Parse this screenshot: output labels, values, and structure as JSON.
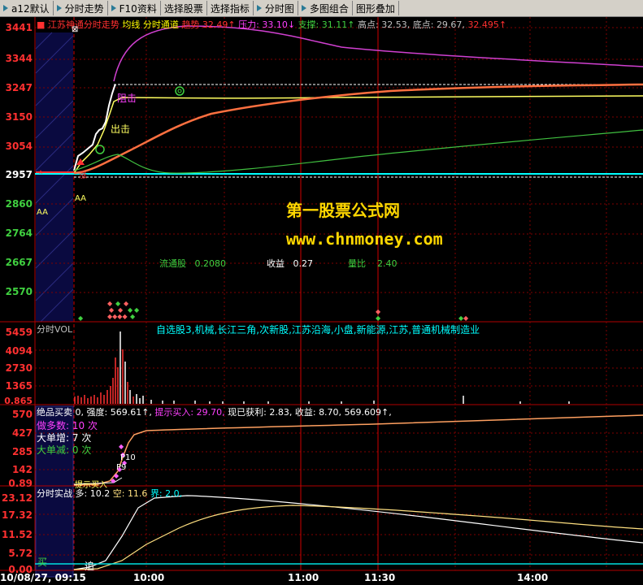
{
  "toolbar": {
    "items": [
      {
        "label": "a12默认",
        "arrow": true
      },
      {
        "label": "分时走势",
        "arrow": true
      },
      {
        "label": "F10资料",
        "arrow": true
      },
      {
        "label": "选择股票",
        "arrow": false
      },
      {
        "label": "选择指标",
        "arrow": false
      },
      {
        "label": "分时图",
        "arrow": true
      },
      {
        "label": "多图组合",
        "arrow": true
      },
      {
        "label": "图形叠加",
        "arrow": false
      }
    ]
  },
  "colors": {
    "bg": "#000000",
    "red": "#ff3030",
    "grid": "#800000",
    "yellow": "#ffff00",
    "cyan": "#00ffff",
    "magenta": "#ff40ff",
    "green": "#40d040",
    "orange": "#ff8040",
    "white": "#ffffff"
  },
  "main_panel": {
    "title": "江苏神通分时走势",
    "avg_line": "均线",
    "channel": "分时通道",
    "trend_label": "趋势",
    "trend_value": "32.49↑",
    "pressure_label": "压力:",
    "pressure_value": "33.10↓",
    "support_label": "支撑:",
    "support_value": "31.11↑",
    "high_label": "高点:",
    "high_value": "32.53,",
    "low_label": "底点:",
    "low_value": "29.67,",
    "extra_value": "32.495↑",
    "y_ticks": [
      "3441",
      "3344",
      "3247",
      "3150",
      "3054",
      "2957",
      "2860",
      "2764",
      "2667",
      "2570"
    ],
    "annotations": {
      "resist": "阻击",
      "strike": "出击",
      "aa1": "AA",
      "aa2": "AA",
      "zhang": "涨"
    },
    "stats": {
      "float_label": "流通股",
      "float_value": "0.2080",
      "eps_label": "收益",
      "eps_value": "0.27",
      "ratio_label": "量比",
      "ratio_value": "2.40"
    }
  },
  "watermark": {
    "line1": "第一股票公式网",
    "line2": "www.chnmoney.com"
  },
  "vol_panel": {
    "title": "分时VOL",
    "tags": "自选股3,机械,长江三角,次新股,江苏沿海,小盘,新能源,江苏,普通机械制造业",
    "y_ticks": [
      "5459",
      "4094",
      "2730",
      "1365",
      "0.865"
    ]
  },
  "buysell_panel": {
    "title": "绝品买卖",
    "intensity_label": "0, 强度:",
    "intensity_value": "569.61↑,",
    "hint_label": "提示买入:",
    "hint_value": "29.70,",
    "profit_label": "现已获利:",
    "profit_value": "2.83,",
    "income_label": "收益:",
    "income_value": "8.70,",
    "last_value": "569.609↑,",
    "stats": [
      {
        "label": "做多数:",
        "value": "10 次"
      },
      {
        "label": "大单增:",
        "value": "7 次"
      },
      {
        "label": "大单减:",
        "value": "0 次"
      }
    ],
    "markers": {
      "p10": "P10",
      "p9": "P9",
      "buy": "提示买入"
    },
    "y_ticks": [
      "570",
      "427",
      "285",
      "142",
      "0.89"
    ]
  },
  "battle_panel": {
    "title": "分时实战",
    "long_label": "多:",
    "long_value": "10.2",
    "short_label": "空:",
    "short_value": "11.6",
    "bound_label": "界:",
    "bound_value": "2.0,",
    "buy_marker": "买",
    "chase_marker": "追",
    "y_ticks": [
      "23.12",
      "17.32",
      "11.52",
      "5.72",
      "0.00"
    ]
  },
  "x_axis": {
    "labels": [
      "10/08/27, 09:15",
      "10:00",
      "11:00",
      "11:30",
      "14:00"
    ]
  }
}
